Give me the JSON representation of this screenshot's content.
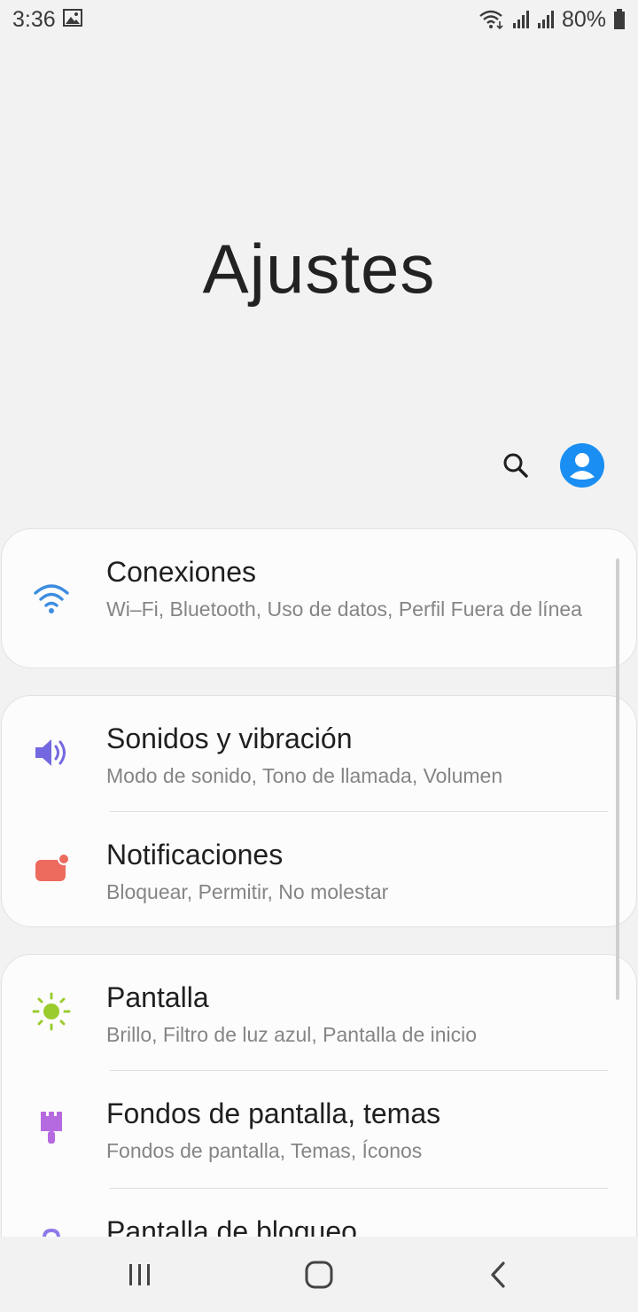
{
  "status_bar": {
    "time": "3:36",
    "battery": "80%",
    "icons": [
      "gallery-icon",
      "wifi-icon",
      "signal-icon",
      "signal-icon",
      "battery-icon"
    ]
  },
  "header": {
    "title": "Ajustes",
    "actions": [
      "search-icon",
      "profile-icon"
    ]
  },
  "accent_color": "#1a8ef2",
  "settings": {
    "conexiones": {
      "title": "Conexiones",
      "subtitle": "Wi–Fi, Bluetooth, Uso de datos, Perfil Fuera de línea",
      "icon": "wifi-icon",
      "color": "#3d8de0"
    },
    "sonidos": {
      "title": "Sonidos y vibración",
      "subtitle": "Modo de sonido, Tono de llamada, Volumen",
      "icon": "speaker-icon",
      "color": "#7468e0"
    },
    "notificaciones": {
      "title": "Notificaciones",
      "subtitle": "Bloquear, Permitir, No molestar",
      "icon": "notification-icon",
      "color": "#ec6a5e"
    },
    "pantalla": {
      "title": "Pantalla",
      "subtitle": "Brillo, Filtro de luz azul, Pantalla de inicio",
      "icon": "sun-icon",
      "color": "#9bcc2e"
    },
    "fondos": {
      "title": "Fondos de pantalla, temas",
      "subtitle": "Fondos de pantalla, Temas, Íconos",
      "icon": "paint-brush-icon",
      "color": "#b56ae0"
    },
    "bloqueo": {
      "title": "Pantalla de bloqueo",
      "icon": "lock-icon",
      "color": "#8f7ae8"
    }
  },
  "nav_bar": [
    "recents-icon",
    "home-icon",
    "back-icon"
  ]
}
